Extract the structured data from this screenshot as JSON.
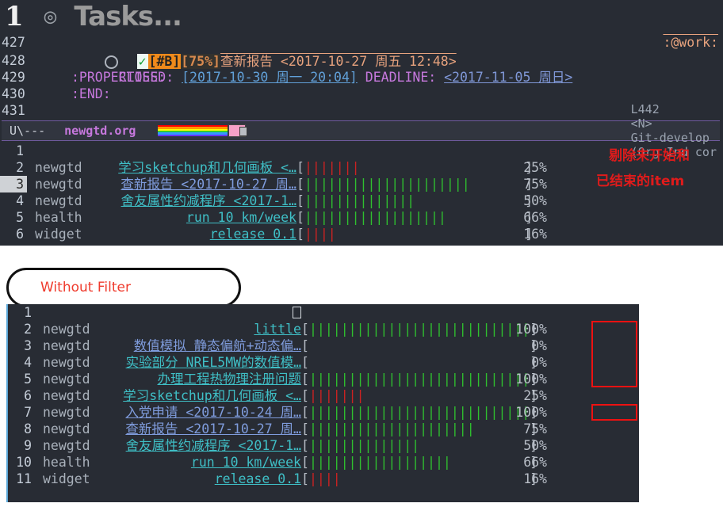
{
  "editor": {
    "header": {
      "number": "1",
      "bullet": "◎",
      "title": "Tasks..."
    },
    "source_lines": [
      {
        "num": "427",
        "kind": "headline",
        "checkbox": "◯",
        "check": "✓",
        "priority": "[#B]",
        "percent": "[75%]",
        "text": "查新报告 <2017-10-27 周五 12:48>",
        "tag": ":@work:"
      },
      {
        "num": "428",
        "kind": "closed",
        "keyword": "CLOSED:",
        "stamp": "[2017-10-30 周一 20:04]",
        "keyword2": "DEADLINE:",
        "stamp2": "<2017-11-05 周日>"
      },
      {
        "num": "429",
        "kind": "drawer",
        "text": ":PROPERTIES:"
      },
      {
        "num": "430",
        "kind": "drawer",
        "text": ":END:"
      },
      {
        "num": "431",
        "kind": "blank",
        "text": ""
      }
    ],
    "modeline": {
      "left": "U\\---",
      "file": "newgtd.org",
      "line": "L442",
      "mode_state": "<N>",
      "branch": "Git-develop",
      "modes": "(Org Ind cor"
    }
  },
  "filtered_report": {
    "annotation": [
      "剔除未开始和",
      "已结束的item"
    ],
    "cursor_row": 3,
    "rows": [
      {
        "num": "1",
        "category": "",
        "task": "",
        "bar": "",
        "pct": "",
        "color": ""
      },
      {
        "num": "2",
        "category": "newgtd",
        "task": "学习sketchup和几何画板 <…",
        "bar": "25",
        "pct": "25%",
        "color": "red"
      },
      {
        "num": "3",
        "category": "newgtd",
        "task": "查新报告 <2017-10-27 周…",
        "bar": "75",
        "pct": "75%",
        "color": "green"
      },
      {
        "num": "4",
        "category": "newgtd",
        "task": "舍友属性约减程序 <2017-1…",
        "bar": "50",
        "pct": "50%",
        "color": "green"
      },
      {
        "num": "5",
        "category": "health",
        "task": "run 10 km/week",
        "bar": "66",
        "pct": "66%",
        "color": "green"
      },
      {
        "num": "6",
        "category": "widget",
        "task": "release 0.1",
        "bar": "16",
        "pct": "16%",
        "color": "red"
      }
    ]
  },
  "callout": {
    "label": "Without Filter"
  },
  "unfiltered_report": {
    "rows": [
      {
        "num": "1",
        "category": "",
        "task": "",
        "bar": "",
        "pct": "",
        "color": "",
        "highlight": false
      },
      {
        "num": "2",
        "category": "newgtd",
        "task": "little",
        "bar": "100",
        "pct": "100%",
        "color": "green",
        "highlight": true
      },
      {
        "num": "3",
        "category": "newgtd",
        "task": "数值模拟 静态偏航+动态偏…",
        "bar": "0",
        "pct": "0%",
        "color": "none",
        "highlight": true
      },
      {
        "num": "4",
        "category": "newgtd",
        "task": "实验部分 NREL5MW的数值模…",
        "bar": "0",
        "pct": "0%",
        "color": "none",
        "highlight": true
      },
      {
        "num": "5",
        "category": "newgtd",
        "task": "办理工程热物理注册问题",
        "bar": "100",
        "pct": "100%",
        "color": "green",
        "highlight": true
      },
      {
        "num": "6",
        "category": "newgtd",
        "task": "学习sketchup和几何画板 <…",
        "bar": "25",
        "pct": "25%",
        "color": "red",
        "highlight": false
      },
      {
        "num": "7",
        "category": "newgtd",
        "task": "入党申请 <2017-10-24 周…",
        "bar": "100",
        "pct": "100%",
        "color": "green",
        "highlight": true
      },
      {
        "num": "8",
        "category": "newgtd",
        "task": "查新报告 <2017-10-27 周…",
        "bar": "75",
        "pct": "75%",
        "color": "green",
        "highlight": false
      },
      {
        "num": "9",
        "category": "newgtd",
        "task": "舍友属性约减程序 <2017-1…",
        "bar": "50",
        "pct": "50%",
        "color": "green",
        "highlight": false
      },
      {
        "num": "10",
        "category": "health",
        "task": "run 10 km/week",
        "bar": "66",
        "pct": "66%",
        "color": "green",
        "highlight": false
      },
      {
        "num": "11",
        "category": "widget",
        "task": "release 0.1",
        "bar": "16",
        "pct": "16%",
        "color": "red",
        "highlight": false
      }
    ]
  },
  "colors": {
    "background": "#282c34",
    "accent_cyan": "#3fbfc6",
    "accent_blue": "#7f9cdd",
    "bar_green": "#2fbf2f",
    "bar_red": "#cc2222",
    "annotation_red": "#e01b1b",
    "priority_orange": "#ef8a1b",
    "modeline_purple": "#c678dd"
  }
}
